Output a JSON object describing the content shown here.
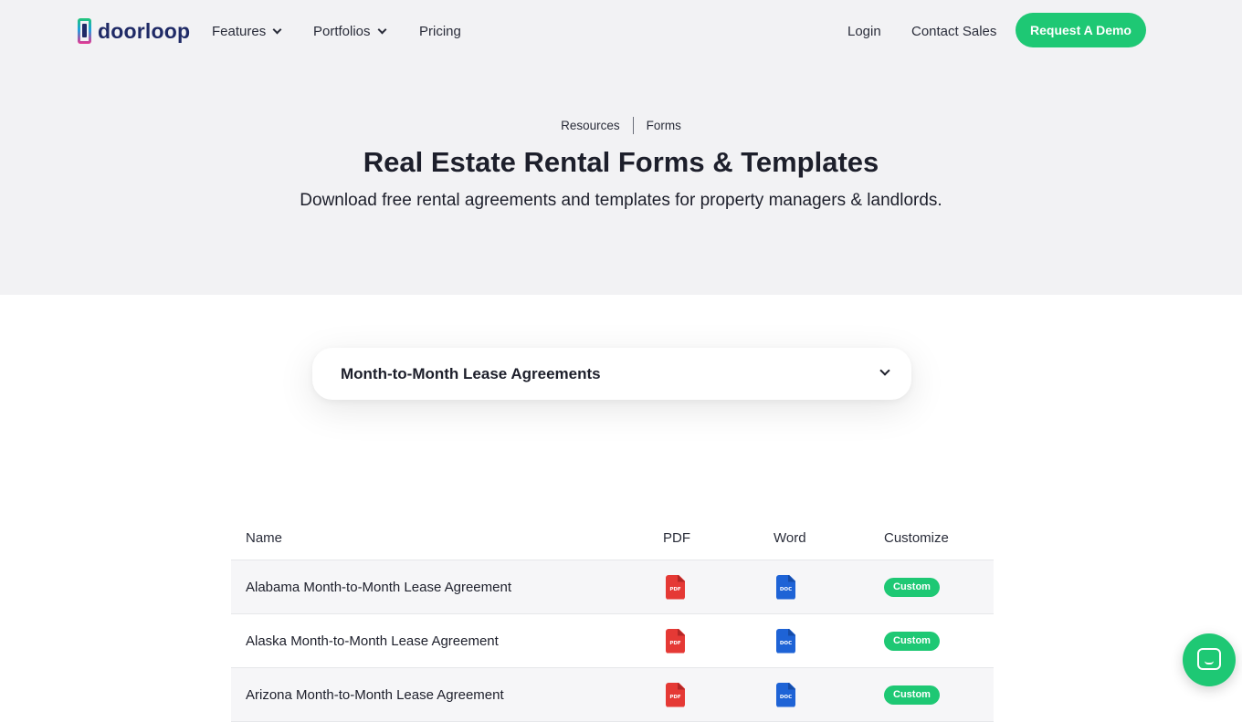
{
  "brand": {
    "name": "doorloop",
    "accent": "#1ec874",
    "navy": "#1f2a66"
  },
  "nav": {
    "features": "Features",
    "portfolios": "Portfolios",
    "pricing": "Pricing",
    "login": "Login",
    "contact": "Contact Sales",
    "demo": "Request A Demo"
  },
  "breadcrumb": {
    "resources": "Resources",
    "forms": "Forms"
  },
  "hero": {
    "title": "Real Estate Rental Forms & Templates",
    "subtitle": "Download free rental agreements and templates for property managers & landlords."
  },
  "filter": {
    "selected": "Month-to-Month Lease Agreements"
  },
  "table": {
    "headers": {
      "name": "Name",
      "pdf": "PDF",
      "word": "Word",
      "customize": "Customize"
    },
    "rows": [
      {
        "name": "Alabama Month-to-Month Lease Agreement",
        "pdf_icon": "pdf-file-icon",
        "pdf_tag": "PDF",
        "word_icon": "doc-file-icon",
        "word_tag": "DOC",
        "action": "Custom"
      },
      {
        "name": "Alaska Month-to-Month Lease Agreement",
        "pdf_icon": "pdf-file-icon",
        "pdf_tag": "PDF",
        "word_icon": "doc-file-icon",
        "word_tag": "DOC",
        "action": "Custom"
      },
      {
        "name": "Arizona Month-to-Month Lease Agreement",
        "pdf_icon": "pdf-file-icon",
        "pdf_tag": "PDF",
        "word_icon": "doc-file-icon",
        "word_tag": "DOC",
        "action": "Custom"
      }
    ]
  },
  "chat": {
    "icon": "chat-bubble-icon"
  }
}
